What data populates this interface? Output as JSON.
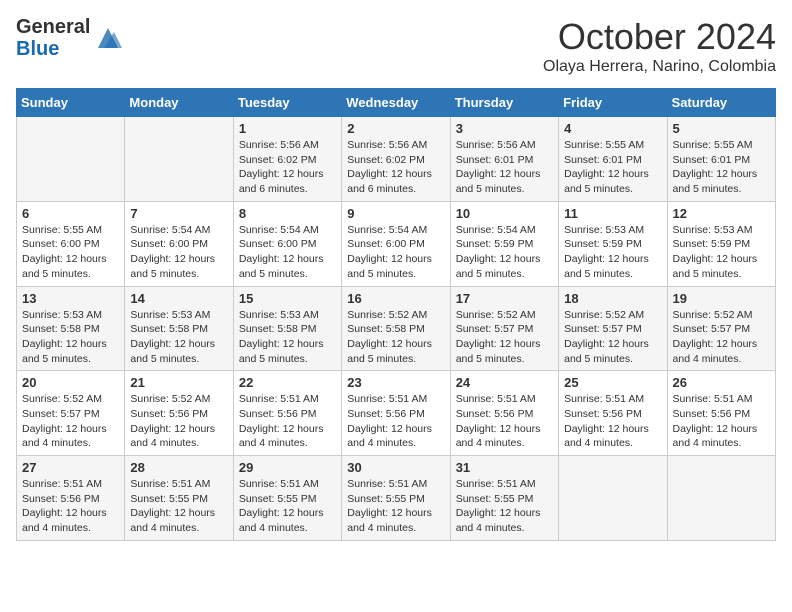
{
  "header": {
    "logo_line1": "General",
    "logo_line2": "Blue",
    "month_title": "October 2024",
    "location": "Olaya Herrera, Narino, Colombia"
  },
  "days_of_week": [
    "Sunday",
    "Monday",
    "Tuesday",
    "Wednesday",
    "Thursday",
    "Friday",
    "Saturday"
  ],
  "weeks": [
    [
      {
        "day": "",
        "info": ""
      },
      {
        "day": "",
        "info": ""
      },
      {
        "day": "1",
        "info": "Sunrise: 5:56 AM\nSunset: 6:02 PM\nDaylight: 12 hours and 6 minutes."
      },
      {
        "day": "2",
        "info": "Sunrise: 5:56 AM\nSunset: 6:02 PM\nDaylight: 12 hours and 6 minutes."
      },
      {
        "day": "3",
        "info": "Sunrise: 5:56 AM\nSunset: 6:01 PM\nDaylight: 12 hours and 5 minutes."
      },
      {
        "day": "4",
        "info": "Sunrise: 5:55 AM\nSunset: 6:01 PM\nDaylight: 12 hours and 5 minutes."
      },
      {
        "day": "5",
        "info": "Sunrise: 5:55 AM\nSunset: 6:01 PM\nDaylight: 12 hours and 5 minutes."
      }
    ],
    [
      {
        "day": "6",
        "info": "Sunrise: 5:55 AM\nSunset: 6:00 PM\nDaylight: 12 hours and 5 minutes."
      },
      {
        "day": "7",
        "info": "Sunrise: 5:54 AM\nSunset: 6:00 PM\nDaylight: 12 hours and 5 minutes."
      },
      {
        "day": "8",
        "info": "Sunrise: 5:54 AM\nSunset: 6:00 PM\nDaylight: 12 hours and 5 minutes."
      },
      {
        "day": "9",
        "info": "Sunrise: 5:54 AM\nSunset: 6:00 PM\nDaylight: 12 hours and 5 minutes."
      },
      {
        "day": "10",
        "info": "Sunrise: 5:54 AM\nSunset: 5:59 PM\nDaylight: 12 hours and 5 minutes."
      },
      {
        "day": "11",
        "info": "Sunrise: 5:53 AM\nSunset: 5:59 PM\nDaylight: 12 hours and 5 minutes."
      },
      {
        "day": "12",
        "info": "Sunrise: 5:53 AM\nSunset: 5:59 PM\nDaylight: 12 hours and 5 minutes."
      }
    ],
    [
      {
        "day": "13",
        "info": "Sunrise: 5:53 AM\nSunset: 5:58 PM\nDaylight: 12 hours and 5 minutes."
      },
      {
        "day": "14",
        "info": "Sunrise: 5:53 AM\nSunset: 5:58 PM\nDaylight: 12 hours and 5 minutes."
      },
      {
        "day": "15",
        "info": "Sunrise: 5:53 AM\nSunset: 5:58 PM\nDaylight: 12 hours and 5 minutes."
      },
      {
        "day": "16",
        "info": "Sunrise: 5:52 AM\nSunset: 5:58 PM\nDaylight: 12 hours and 5 minutes."
      },
      {
        "day": "17",
        "info": "Sunrise: 5:52 AM\nSunset: 5:57 PM\nDaylight: 12 hours and 5 minutes."
      },
      {
        "day": "18",
        "info": "Sunrise: 5:52 AM\nSunset: 5:57 PM\nDaylight: 12 hours and 5 minutes."
      },
      {
        "day": "19",
        "info": "Sunrise: 5:52 AM\nSunset: 5:57 PM\nDaylight: 12 hours and 4 minutes."
      }
    ],
    [
      {
        "day": "20",
        "info": "Sunrise: 5:52 AM\nSunset: 5:57 PM\nDaylight: 12 hours and 4 minutes."
      },
      {
        "day": "21",
        "info": "Sunrise: 5:52 AM\nSunset: 5:56 PM\nDaylight: 12 hours and 4 minutes."
      },
      {
        "day": "22",
        "info": "Sunrise: 5:51 AM\nSunset: 5:56 PM\nDaylight: 12 hours and 4 minutes."
      },
      {
        "day": "23",
        "info": "Sunrise: 5:51 AM\nSunset: 5:56 PM\nDaylight: 12 hours and 4 minutes."
      },
      {
        "day": "24",
        "info": "Sunrise: 5:51 AM\nSunset: 5:56 PM\nDaylight: 12 hours and 4 minutes."
      },
      {
        "day": "25",
        "info": "Sunrise: 5:51 AM\nSunset: 5:56 PM\nDaylight: 12 hours and 4 minutes."
      },
      {
        "day": "26",
        "info": "Sunrise: 5:51 AM\nSunset: 5:56 PM\nDaylight: 12 hours and 4 minutes."
      }
    ],
    [
      {
        "day": "27",
        "info": "Sunrise: 5:51 AM\nSunset: 5:56 PM\nDaylight: 12 hours and 4 minutes."
      },
      {
        "day": "28",
        "info": "Sunrise: 5:51 AM\nSunset: 5:55 PM\nDaylight: 12 hours and 4 minutes."
      },
      {
        "day": "29",
        "info": "Sunrise: 5:51 AM\nSunset: 5:55 PM\nDaylight: 12 hours and 4 minutes."
      },
      {
        "day": "30",
        "info": "Sunrise: 5:51 AM\nSunset: 5:55 PM\nDaylight: 12 hours and 4 minutes."
      },
      {
        "day": "31",
        "info": "Sunrise: 5:51 AM\nSunset: 5:55 PM\nDaylight: 12 hours and 4 minutes."
      },
      {
        "day": "",
        "info": ""
      },
      {
        "day": "",
        "info": ""
      }
    ]
  ]
}
